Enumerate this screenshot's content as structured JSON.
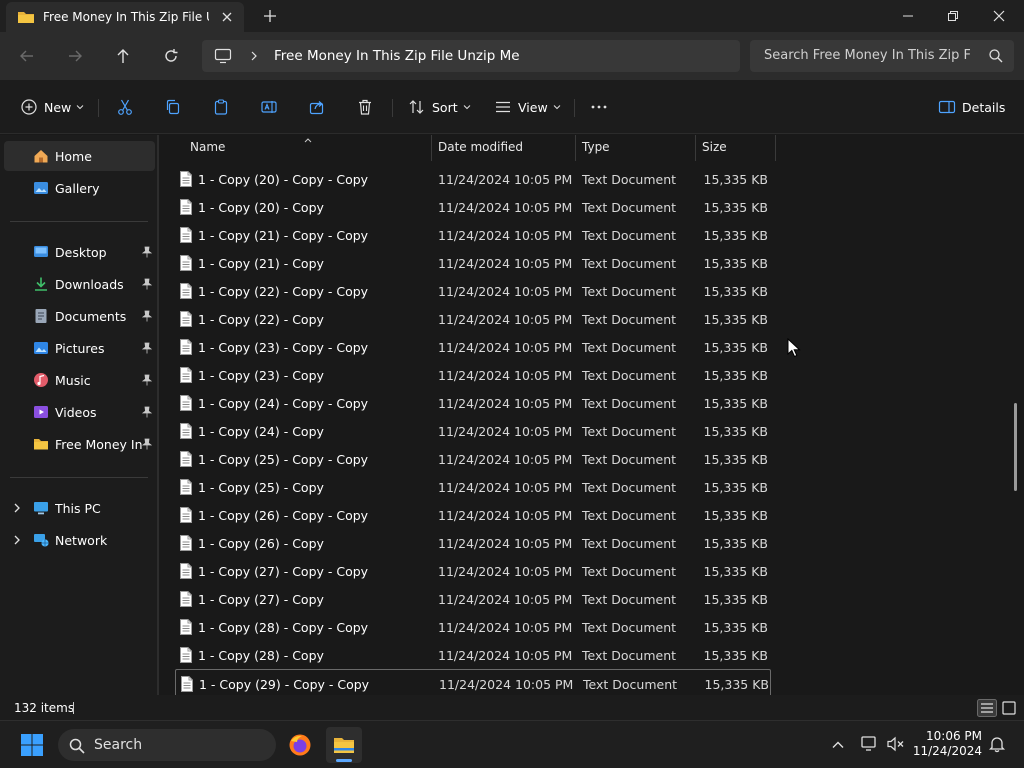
{
  "window": {
    "tab_title": "Free Money In This Zip File Un",
    "new_tab_icon": "plus-icon"
  },
  "address": {
    "path": "Free Money In This Zip File Unzip Me",
    "search_placeholder": "Search Free Money In This Zip File Unzip Me"
  },
  "commands": {
    "new_label": "New",
    "sort_label": "Sort",
    "view_label": "View",
    "details_label": "Details"
  },
  "sidebar": {
    "home": "Home",
    "gallery": "Gallery",
    "desktop": "Desktop",
    "downloads": "Downloads",
    "documents": "Documents",
    "pictures": "Pictures",
    "music": "Music",
    "videos": "Videos",
    "free_money": "Free Money In This Zip File Unzip Me",
    "this_pc": "This PC",
    "network": "Network"
  },
  "columns": {
    "name": "Name",
    "date": "Date modified",
    "type": "Type",
    "size": "Size"
  },
  "files": [
    {
      "name": "1 - Copy (20) - Copy - Copy",
      "date": "11/24/2024 10:05 PM",
      "type": "Text Document",
      "size": "15,335 KB"
    },
    {
      "name": "1 - Copy (20) - Copy",
      "date": "11/24/2024 10:05 PM",
      "type": "Text Document",
      "size": "15,335 KB"
    },
    {
      "name": "1 - Copy (21) - Copy - Copy",
      "date": "11/24/2024 10:05 PM",
      "type": "Text Document",
      "size": "15,335 KB"
    },
    {
      "name": "1 - Copy (21) - Copy",
      "date": "11/24/2024 10:05 PM",
      "type": "Text Document",
      "size": "15,335 KB"
    },
    {
      "name": "1 - Copy (22) - Copy - Copy",
      "date": "11/24/2024 10:05 PM",
      "type": "Text Document",
      "size": "15,335 KB"
    },
    {
      "name": "1 - Copy (22) - Copy",
      "date": "11/24/2024 10:05 PM",
      "type": "Text Document",
      "size": "15,335 KB"
    },
    {
      "name": "1 - Copy (23) - Copy - Copy",
      "date": "11/24/2024 10:05 PM",
      "type": "Text Document",
      "size": "15,335 KB"
    },
    {
      "name": "1 - Copy (23) - Copy",
      "date": "11/24/2024 10:05 PM",
      "type": "Text Document",
      "size": "15,335 KB"
    },
    {
      "name": "1 - Copy (24) - Copy - Copy",
      "date": "11/24/2024 10:05 PM",
      "type": "Text Document",
      "size": "15,335 KB"
    },
    {
      "name": "1 - Copy (24) - Copy",
      "date": "11/24/2024 10:05 PM",
      "type": "Text Document",
      "size": "15,335 KB"
    },
    {
      "name": "1 - Copy (25) - Copy - Copy",
      "date": "11/24/2024 10:05 PM",
      "type": "Text Document",
      "size": "15,335 KB"
    },
    {
      "name": "1 - Copy (25) - Copy",
      "date": "11/24/2024 10:05 PM",
      "type": "Text Document",
      "size": "15,335 KB"
    },
    {
      "name": "1 - Copy (26) - Copy - Copy",
      "date": "11/24/2024 10:05 PM",
      "type": "Text Document",
      "size": "15,335 KB"
    },
    {
      "name": "1 - Copy (26) - Copy",
      "date": "11/24/2024 10:05 PM",
      "type": "Text Document",
      "size": "15,335 KB"
    },
    {
      "name": "1 - Copy (27) - Copy - Copy",
      "date": "11/24/2024 10:05 PM",
      "type": "Text Document",
      "size": "15,335 KB"
    },
    {
      "name": "1 - Copy (27) - Copy",
      "date": "11/24/2024 10:05 PM",
      "type": "Text Document",
      "size": "15,335 KB"
    },
    {
      "name": "1 - Copy (28) - Copy - Copy",
      "date": "11/24/2024 10:05 PM",
      "type": "Text Document",
      "size": "15,335 KB"
    },
    {
      "name": "1 - Copy (28) - Copy",
      "date": "11/24/2024 10:05 PM",
      "type": "Text Document",
      "size": "15,335 KB"
    },
    {
      "name": "1 - Copy (29) - Copy - Copy",
      "date": "11/24/2024 10:05 PM",
      "type": "Text Document",
      "size": "15,335 KB"
    }
  ],
  "status": {
    "item_count": "132 items"
  },
  "taskbar": {
    "search_label": "Search",
    "time": "10:06 PM",
    "date": "11/24/2024"
  },
  "colors": {
    "accent": "#5ca8ff",
    "folder": "#f4c542"
  }
}
